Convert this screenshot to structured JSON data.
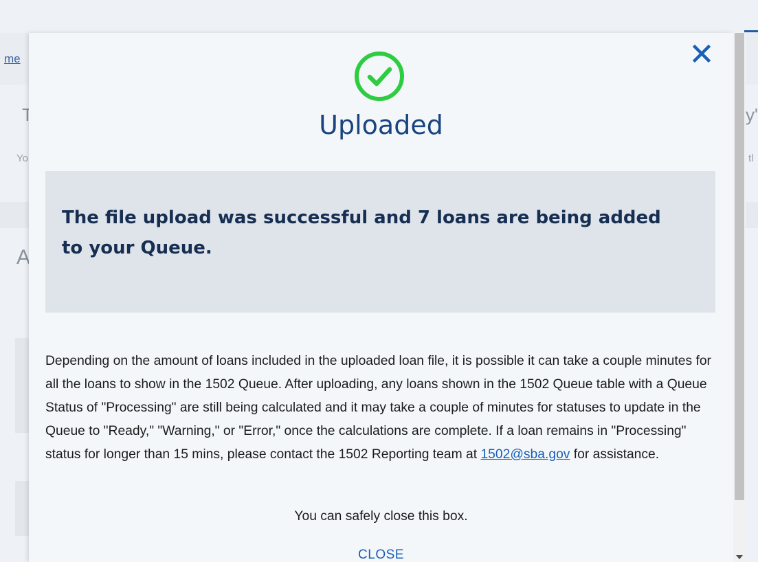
{
  "background": {
    "breadcrumb_link": "me",
    "heading_left": "Tl",
    "heading_right": "y'",
    "text_left": "Yo",
    "text_right": "tl",
    "section_letter": "A"
  },
  "modal": {
    "title": "Uploaded",
    "status_icon": "check-circle-icon",
    "alert_message": "The file upload was successful and 7 loans are being added to your Queue.",
    "body_text_before_link": "Depending on the amount of loans included in the uploaded loan file, it is possible it can take a couple minutes for all the loans to show in the 1502 Queue. After uploading, any loans shown in the 1502 Queue table with a Queue Status of \"Processing\" are still being calculated and it may take a couple of minutes for statuses to update in the Queue to \"Ready,\" \"Warning,\" or \"Error,\" once the calculations are complete. If a loan remains in \"Processing\" status for longer than 15 mins, please contact the 1502 Reporting team at ",
    "email_link": "1502@sba.gov",
    "body_text_after_link": " for assistance.",
    "safe_close_text": "You can safely close this box.",
    "close_button_label": "CLOSE",
    "close_icon": "close-icon"
  },
  "colors": {
    "title": "#1a4480",
    "success_green": "#2ecc40",
    "close_x": "#1a5fb4",
    "alert_bg": "#dfe4eb",
    "link": "#1a5fb4"
  }
}
